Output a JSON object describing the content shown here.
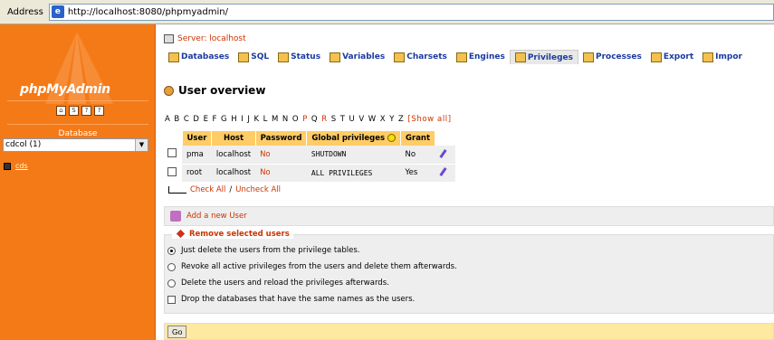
{
  "browser": {
    "address_label": "Address",
    "url": "http://localhost:8080/phpmyadmin/"
  },
  "left": {
    "logo": "phpMyAdmin",
    "database_label": "Database",
    "database_selected": "cdcol (1)",
    "db_link": "cds"
  },
  "server": {
    "label": "Server: localhost"
  },
  "tabs": [
    "Databases",
    "SQL",
    "Status",
    "Variables",
    "Charsets",
    "Engines",
    "Privileges",
    "Processes",
    "Export",
    "Impor"
  ],
  "page": {
    "title": "User overview"
  },
  "alphabet": [
    "A",
    "B",
    "C",
    "D",
    "E",
    "F",
    "G",
    "H",
    "I",
    "J",
    "K",
    "L",
    "M",
    "N",
    "O",
    "P",
    "Q",
    "R",
    "S",
    "T",
    "U",
    "V",
    "W",
    "X",
    "Y",
    "Z"
  ],
  "alphabet_links": [
    "P",
    "R"
  ],
  "show_all": "[Show all]",
  "table": {
    "headers": [
      "User",
      "Host",
      "Password",
      "Global privileges",
      "Grant"
    ],
    "rows": [
      {
        "user": "pma",
        "host": "localhost",
        "password": "No",
        "privileges": "SHUTDOWN",
        "grant": "No"
      },
      {
        "user": "root",
        "host": "localhost",
        "password": "No",
        "privileges": "ALL PRIVILEGES",
        "grant": "Yes"
      }
    ]
  },
  "check_all": "Check All",
  "separator": "/",
  "uncheck_all": "Uncheck All",
  "add_user": "Add a new User",
  "remove": {
    "legend": "Remove selected users",
    "options": [
      "Just delete the users from the privilege tables.",
      "Revoke all active privileges from the users and delete them afterwards.",
      "Delete the users and reload the privileges afterwards."
    ],
    "drop_checkbox": "Drop the databases that have the same names as the users."
  },
  "go_button": "Go"
}
